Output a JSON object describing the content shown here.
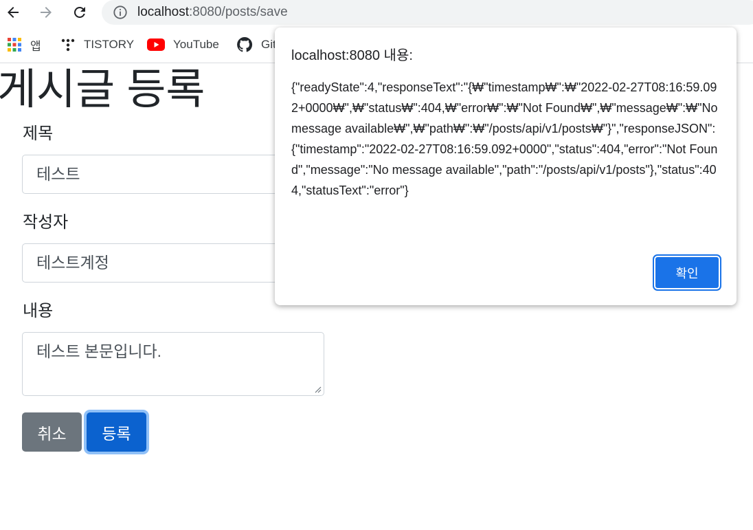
{
  "browser": {
    "url_host": "localhost",
    "url_path": ":8080/posts/save"
  },
  "bookmarks": [
    {
      "label": "앱",
      "icon": "apps-grid-icon"
    },
    {
      "label": "TISTORY",
      "icon": "tistory-icon"
    },
    {
      "label": "YouTube",
      "icon": "youtube-icon"
    },
    {
      "label": "Git",
      "icon": "github-icon"
    }
  ],
  "page": {
    "title": "게시글 등록",
    "title_label": "제목",
    "title_value": "테스트",
    "author_label": "작성자",
    "author_value": "테스트계정",
    "content_label": "내용",
    "content_value": "테스트 본문입니다.",
    "cancel_label": "취소",
    "save_label": "등록"
  },
  "dialog": {
    "title": "localhost:8080 내용:",
    "message": "{\"readyState\":4,\"responseText\":\"{₩\"timestamp₩\":₩\"2022-02-27T08:16:59.092+0000₩\",₩\"status₩\":404,₩\"error₩\":₩\"Not Found₩\",₩\"message₩\":₩\"No message available₩\",₩\"path₩\":₩\"/posts/api/v1/posts₩\"}\",\"responseJSON\":{\"timestamp\":\"2022-02-27T08:16:59.092+0000\",\"status\":404,\"error\":\"Not Found\",\"message\":\"No message available\",\"path\":\"/posts/api/v1/posts\"},\"status\":404,\"statusText\":\"error\"}",
    "ok_label": "확인"
  }
}
